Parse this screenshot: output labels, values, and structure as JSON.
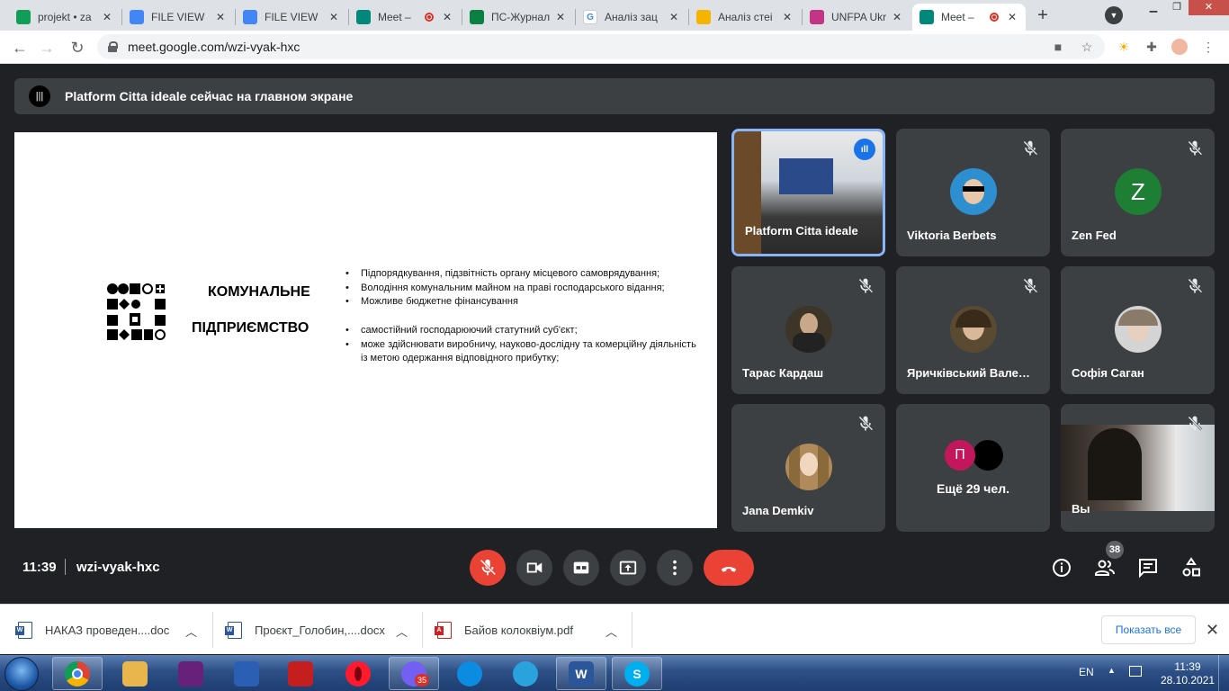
{
  "browser": {
    "tabs": [
      {
        "title": "projekt • za",
        "icon": "sheets-icon",
        "color": "#0f9d58"
      },
      {
        "title": "FILE VIEW",
        "icon": "doc-icon",
        "color": "#4285f4"
      },
      {
        "title": "FILE VIEW",
        "icon": "doc-icon",
        "color": "#4285f4"
      },
      {
        "title": "Meet –",
        "icon": "meet-icon",
        "color": "#00897b",
        "recording": true
      },
      {
        "title": "ПС-Журнал",
        "icon": "journal-icon",
        "color": "#0b8043"
      },
      {
        "title": "Аналіз зац",
        "icon": "google-icon",
        "color": "#4285f4"
      },
      {
        "title": "Аналіз стеі",
        "icon": "slides-icon",
        "color": "#f4b400"
      },
      {
        "title": "UNFPA Ukr",
        "icon": "instagram-icon",
        "color": "#c13584"
      },
      {
        "title": "Meet –",
        "icon": "meet-icon",
        "color": "#00897b",
        "recording": true,
        "active": true
      }
    ],
    "url": "meet.google.com/wzi-vyak-hxc"
  },
  "banner": {
    "text": "Platform Citta ideale сейчас на главном экране"
  },
  "slide": {
    "title_line1": "КОМУНАЛЬНЕ",
    "title_line2": "ПІДПРИЄМСТВО",
    "bullets_a": [
      "Підпорядкування, підзвітність органу місцевого самоврядування;",
      "Володіння комунальним майном на праві господарського відання;",
      "Можливе бюджетне фінансування"
    ],
    "bullets_b": [
      "самостійний господарюючий статутний суб'єкт;",
      "може здійснювати виробничу, науково-дослідну та комерційну діяльність із метою одержання відповідного прибутку;"
    ]
  },
  "participants": [
    {
      "name": "Platform Citta ideale",
      "type": "video-room",
      "speaking": true
    },
    {
      "name": "Viktoria Berbets",
      "type": "photo",
      "color": "#2d8fd0",
      "muted": true
    },
    {
      "name": "Zen Fed",
      "type": "letter",
      "letter": "Z",
      "color": "#1e7e34",
      "muted": true
    },
    {
      "name": "Тарас Кардаш",
      "type": "photo",
      "color": "#3d3528",
      "muted": true
    },
    {
      "name": "Яричківський Вале…",
      "type": "photo",
      "color": "#4a4232",
      "muted": true
    },
    {
      "name": "Софія Саган",
      "type": "photo",
      "color": "#c9c9c9",
      "muted": true
    },
    {
      "name": "Jana Demkiv",
      "type": "photo",
      "color": "#b08a5a",
      "muted": true
    },
    {
      "name": "Ещё 29 чел.",
      "type": "more",
      "letter": "П",
      "color": "#c2185b"
    },
    {
      "name": "Вы",
      "type": "self-video",
      "muted": true
    }
  ],
  "controls": {
    "time": "11:39",
    "code": "wzi-vyak-hxc",
    "people_count": "38"
  },
  "downloads": {
    "items": [
      {
        "name": "НАКАЗ проведен....doc",
        "type": "word"
      },
      {
        "name": "Проєкт_Голобин,....docx",
        "type": "word"
      },
      {
        "name": "Байов колоквіум.pdf",
        "type": "pdf"
      }
    ],
    "show_all": "Показать все"
  },
  "taskbar": {
    "apps": [
      {
        "name": "chrome",
        "color": "#db4437",
        "label": ""
      },
      {
        "name": "explorer",
        "color": "#e8b64c",
        "label": ""
      },
      {
        "name": "visual-studio",
        "color": "#68217a",
        "label": ""
      },
      {
        "name": "save-app",
        "color": "#2b5fb4",
        "label": ""
      },
      {
        "name": "acrobat",
        "color": "#c41e1e",
        "label": ""
      },
      {
        "name": "opera",
        "color": "#ff1b2d",
        "label": ""
      },
      {
        "name": "viber",
        "color": "#7360f2",
        "label": "",
        "badge": "35"
      },
      {
        "name": "edge",
        "color": "#0c8ce0",
        "label": ""
      },
      {
        "name": "telegram",
        "color": "#2aa3dd",
        "label": ""
      },
      {
        "name": "word",
        "color": "#2b579a",
        "label": "W"
      },
      {
        "name": "skype",
        "color": "#00aff0",
        "label": "S"
      }
    ],
    "lang": "EN",
    "time": "11:39",
    "date": "28.10.2021"
  }
}
